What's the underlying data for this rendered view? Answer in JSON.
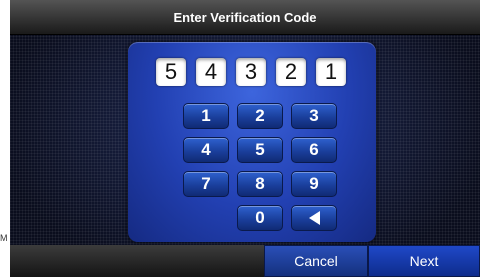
{
  "side_label": "M",
  "title": "Enter Verification Code",
  "code_digits": [
    "5",
    "4",
    "3",
    "2",
    "1"
  ],
  "keypad": {
    "k1": "1",
    "k2": "2",
    "k3": "3",
    "k4": "4",
    "k5": "5",
    "k6": "6",
    "k7": "7",
    "k8": "8",
    "k9": "9",
    "k0": "0",
    "backspace_icon": "backspace-arrow-icon"
  },
  "buttons": {
    "cancel": "Cancel",
    "next": "Next"
  }
}
